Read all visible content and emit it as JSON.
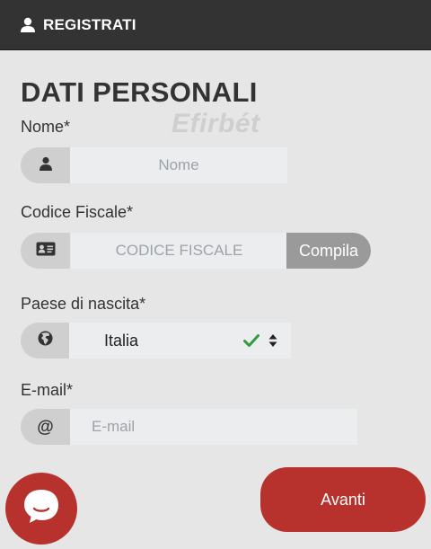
{
  "header": {
    "title": "REGISTRATI",
    "icon": "user-icon"
  },
  "section_title": "DATI PERSONALI",
  "watermark": "Efirbét",
  "fields": {
    "nome": {
      "label": "Nome*",
      "placeholder": "Nome",
      "icon": "user-icon"
    },
    "codice_fiscale": {
      "label": "Codice Fiscale*",
      "placeholder": "CODICE FISCALE",
      "icon": "id-card-icon",
      "button_label": "Compila"
    },
    "paese_nascita": {
      "label": "Paese di nascita*",
      "value": "Italia",
      "icon": "globe-icon"
    },
    "email": {
      "label": "E-mail*",
      "placeholder": "E-mail",
      "icon": "at-icon"
    }
  },
  "avanti_label": "Avanti",
  "colors": {
    "header_bg": "#333333",
    "accent_red": "#b7322c",
    "check_green": "#2e9e3f",
    "compila_bg": "#9a9a9a"
  }
}
